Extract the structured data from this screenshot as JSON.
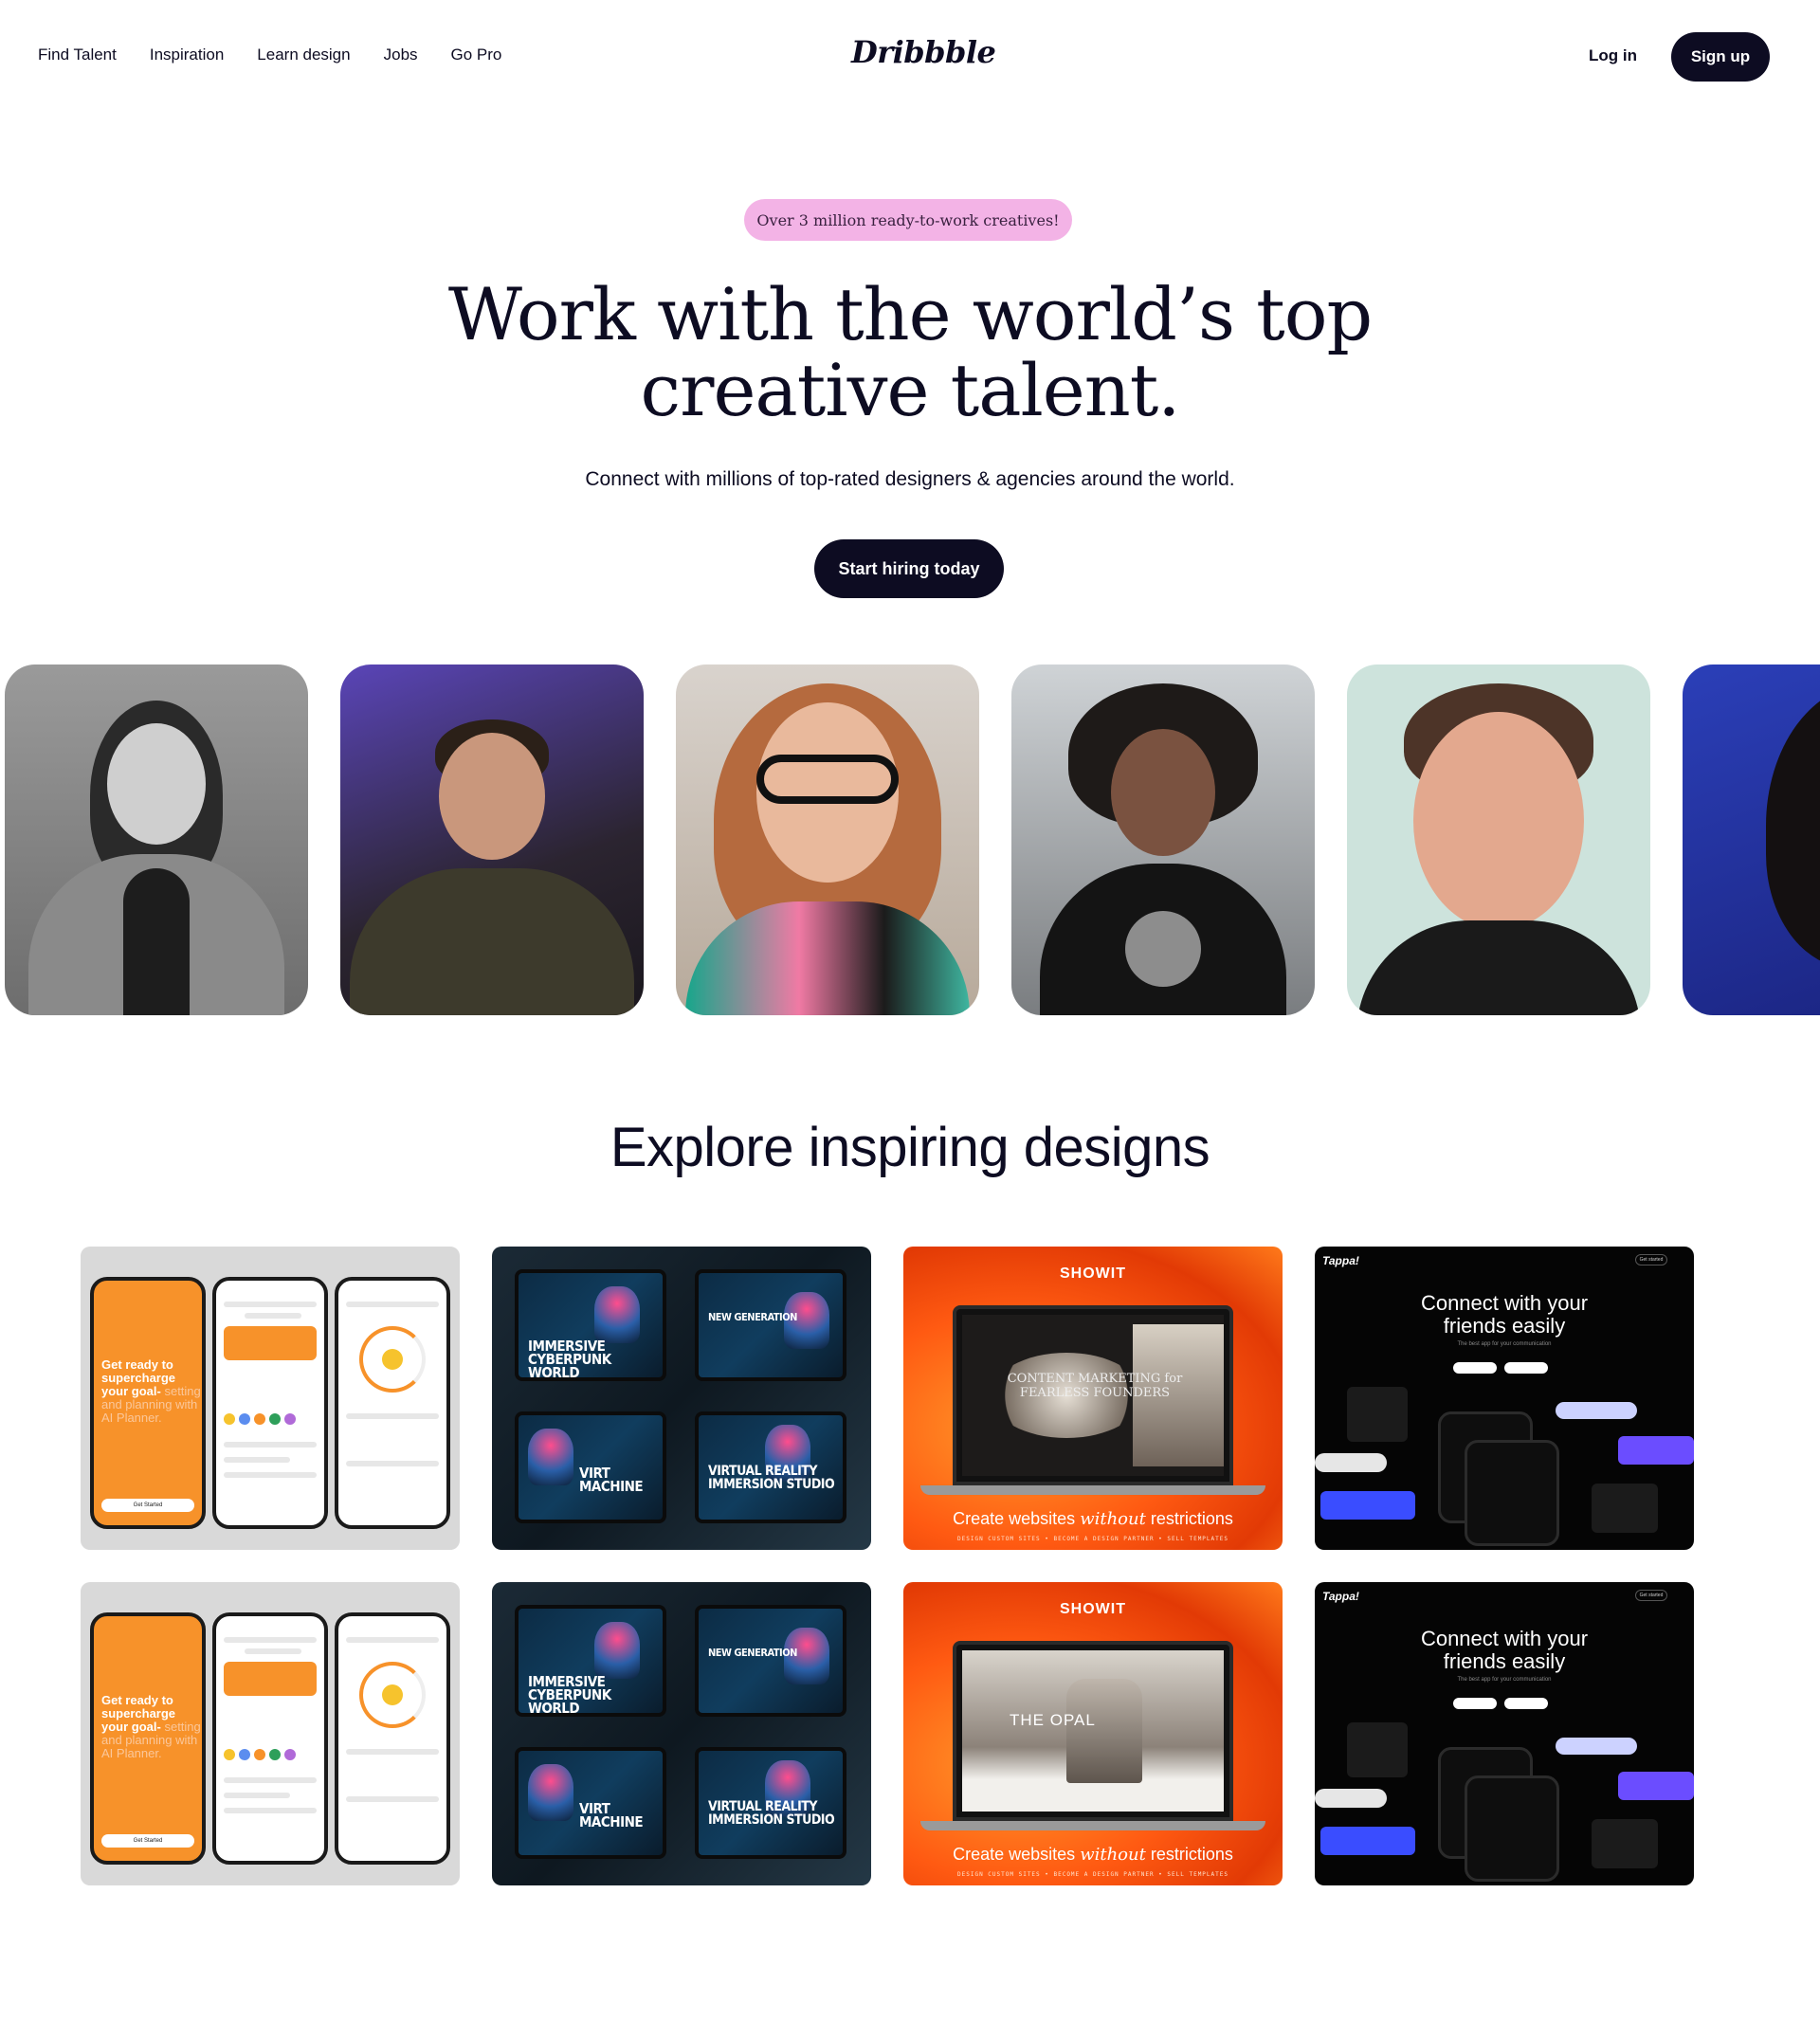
{
  "nav": {
    "links": [
      "Find Talent",
      "Inspiration",
      "Learn design",
      "Jobs",
      "Go Pro"
    ],
    "logo": "Dribbble",
    "login": "Log in",
    "signup": "Sign up"
  },
  "hero": {
    "badge": "Over 3 million ready-to-work creatives!",
    "title_line1": "Work with the world’s top",
    "title_line2": "creative talent.",
    "subtitle": "Connect with millions of top-rated designers & agencies around the world.",
    "cta": "Start hiring today"
  },
  "explore": {
    "title": "Explore inspiring designs"
  },
  "cards": {
    "planner": {
      "headline_bold": "Get ready to supercharge your goal-",
      "headline_light": "setting and planning with AI Planner.",
      "button": "Get Started"
    },
    "cyber": {
      "t1": "IMMERSIVE CYBERPUNK WORLD",
      "t2": "NEW GENERATION",
      "t3": "VIRT MACHINE",
      "t4": "VIRTUAL REALITY IMMERSION STUDIO"
    },
    "showit": {
      "brand": "SHOWIT",
      "screen1": "CONTENT MARKETING for FEARLESS FOUNDERS",
      "screen2": "THE OPAL",
      "tag_before": "Create websites ",
      "tag_em": "without",
      "tag_after": " restrictions",
      "footer": "DESIGN CUSTOM SITES • BECOME A DESIGN PARTNER • SELL TEMPLATES"
    },
    "tappa": {
      "logo": "Tappa!",
      "button": "Get started",
      "headline_line1": "Connect with your",
      "headline_line2": "friends easily",
      "sub": "The best app for your communication"
    }
  },
  "colors": {
    "ink": "#0d0c22",
    "badge_bg": "#f3b3e6",
    "orange": "#f7922a",
    "showit": "#ff5a12"
  }
}
